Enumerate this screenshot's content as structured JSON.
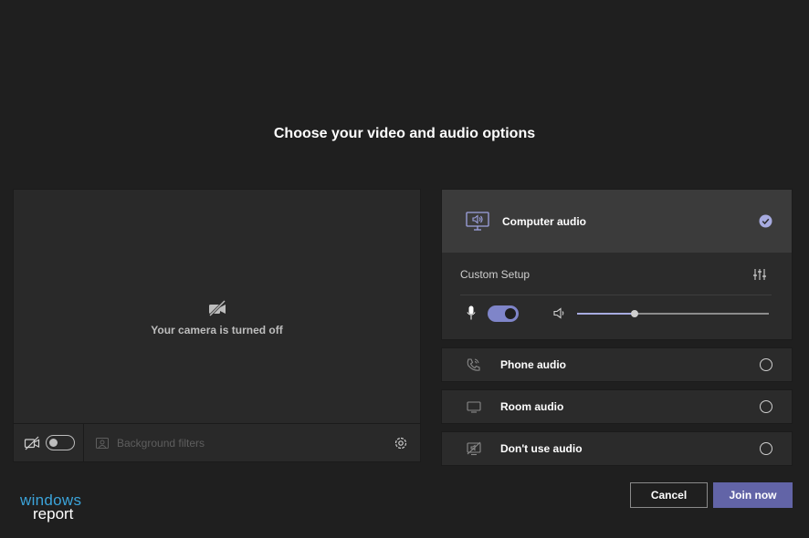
{
  "title": "Choose your video and audio options",
  "video": {
    "camera_off_text": "Your camera is turned off",
    "camera_toggle_on": false,
    "background_filters_label": "Background filters"
  },
  "audio": {
    "computer_audio_label": "Computer audio",
    "computer_audio_selected": true,
    "custom_setup_label": "Custom Setup",
    "mic_toggle_on": true,
    "volume_level": 0.3,
    "options": [
      {
        "label": "Phone audio",
        "icon": "phone-icon",
        "selected": false
      },
      {
        "label": "Room audio",
        "icon": "monitor-icon",
        "selected": false
      },
      {
        "label": "Don't use audio",
        "icon": "speaker-off-icon",
        "selected": false
      }
    ]
  },
  "buttons": {
    "cancel": "Cancel",
    "join": "Join now"
  },
  "watermark": {
    "line1": "windows",
    "line2": "report"
  },
  "colors": {
    "accent": "#6264a7",
    "toggle_on": "#7f85c9",
    "background": "#1f1f1f"
  }
}
